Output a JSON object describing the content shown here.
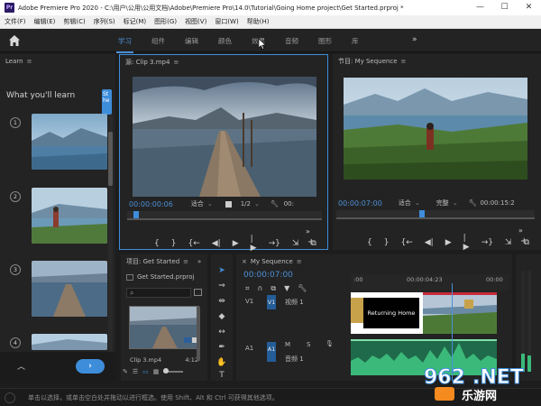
{
  "window": {
    "app_icon": "Pr",
    "title": "Adobe Premiere Pro 2020 - C:\\用户\\公用\\公用文档\\Adobe\\Premiere Pro\\14.0\\Tutorial\\Going Home project\\Get Started.prproj *",
    "minimize": "—",
    "maximize": "☐",
    "close": "✕"
  },
  "menu": [
    "文件(F)",
    "编辑(E)",
    "剪辑(C)",
    "序列(S)",
    "标记(M)",
    "图形(G)",
    "视图(V)",
    "窗口(W)",
    "帮助(H)"
  ],
  "workspace": {
    "tabs": [
      "学习",
      "组件",
      "编辑",
      "颜色",
      "效果",
      "音频",
      "图形",
      "库"
    ],
    "active": "学习",
    "more": "»"
  },
  "learn": {
    "title": "Learn",
    "heading": "What you'll learn",
    "tooltip": "St\nhe",
    "steps": [
      "1",
      "2",
      "3",
      "4"
    ]
  },
  "source": {
    "title": "源: Clip 3.mp4",
    "timecode": "00:00:00:06",
    "fit": "适合",
    "res": "1/2",
    "end_tc": "00:"
  },
  "program": {
    "title": "节目: My Sequence",
    "timecode": "00:00:07:00",
    "fit": "适合",
    "quality": "完整",
    "end_tc": "00:00:15:2"
  },
  "controls": {
    "mark_in": "{",
    "mark_out": "}",
    "go_in": "{←",
    "step_back": "◀|",
    "play": "▶",
    "step_fwd": "|▶",
    "go_out": "→}",
    "insert": "⇲",
    "export": "⧉",
    "add": "+"
  },
  "project": {
    "title": "项目: Get Started",
    "file": "Get Started.prproj",
    "clip_name": "Clip 3.mp4",
    "clip_duration": "4:12"
  },
  "timeline": {
    "title": "My Sequence",
    "timecode": "00:00:07:00",
    "ruler": [
      ":00",
      "00:00:04:23",
      "00:00"
    ],
    "v1_label": "V1",
    "v1_name": "视频 1",
    "a1_label": "A1",
    "a1_name": "音频 1",
    "a1_m": "M",
    "a1_s": "S",
    "title_clip": "Returning Home"
  },
  "status": {
    "text": "单击以选择，或单击空白处并拖动以进行框选。使用 Shift、Alt 和 Ctrl 可获得其他选项。"
  },
  "watermark": {
    "brand": "962.NET",
    "subtitle": "乐游网"
  },
  "colors": {
    "accent": "#3e8ddb",
    "track_target": "#245d97",
    "audio_wave": "#3bb97a"
  }
}
